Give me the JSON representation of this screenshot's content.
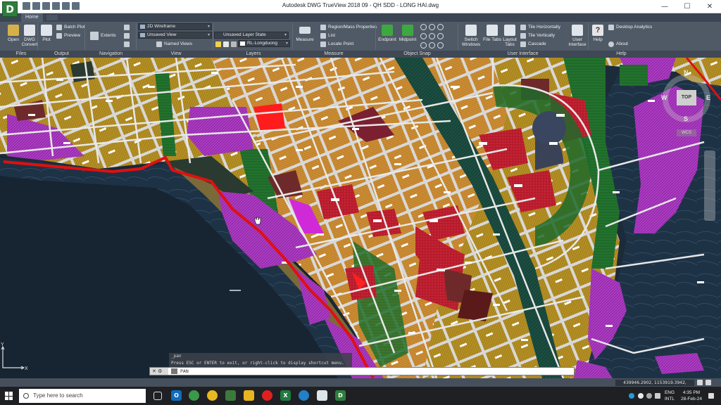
{
  "window": {
    "title": "Autodesk DWG TrueView 2018    09 - QH SDD - LONG HAI.dwg",
    "logo": "D",
    "controls": [
      "—",
      "☐",
      "✕"
    ]
  },
  "tabs": {
    "home": "Home"
  },
  "ribbon": {
    "files": {
      "open": "Open",
      "dwg_convert": "DWG\nConvert",
      "title": "Files"
    },
    "output": {
      "plot": "Plot",
      "batch_plot": "Batch Plot",
      "preview": "Preview",
      "title": "Output"
    },
    "navigation": {
      "extents": "Extents",
      "title": "Navigation"
    },
    "view": {
      "visual_style": "2D Wireframe",
      "named_view": "Unsaved View",
      "named_views": "Named Views",
      "title": "View"
    },
    "layers": {
      "layer_state": "Unsaved Layer State",
      "current_layer": "RL-Longduong",
      "title": "Layers"
    },
    "measure": {
      "measure": "Measure",
      "region_mass": "Region/Mass Properties",
      "list": "List",
      "locate_point": "Locate Point",
      "title": "Measure"
    },
    "object_snap": {
      "endpoint": "Endpoint",
      "midpoint": "Midpoint",
      "title": "Object Snap"
    },
    "user_interface": {
      "switch_windows": "Switch\nWindows",
      "file_tabs": "File Tabs",
      "layout_tabs": "Layout\nTabs",
      "tile_h": "Tile Horizontally",
      "tile_v": "Tile Vertically",
      "cascade": "Cascade",
      "user_interface": "User\nInterface",
      "title": "User Interface"
    },
    "help": {
      "help": "Help",
      "desktop_analytics": "Desktop Analytics",
      "about": "About",
      "title": "Help"
    }
  },
  "viewcube": {
    "top": "TOP",
    "n": "N",
    "s": "S",
    "e": "E",
    "w": "W",
    "wcs": "WCS"
  },
  "ucs": {
    "x": "X",
    "y": "Y"
  },
  "command": {
    "history_1": "_pan",
    "history_2": "Press ESC or ENTER to exit, or right-click to display shortcut menu.",
    "prompt": "PAN"
  },
  "status": {
    "coords": "439946.2902, 1153919.3942, 0.0000"
  },
  "taskbar": {
    "search_placeholder": "Type here to search",
    "lang_1": "ENG",
    "lang_2": "INTL",
    "time": "4:35 PM",
    "date": "28-Feb-24"
  },
  "colors": {
    "land_gold": "#a8841c",
    "land_orange": "#c0822a",
    "land_red": "#b81c2c",
    "land_maroon": "#6e2a2a",
    "land_green": "#1f6a2a",
    "land_purple": "#9a2cb0",
    "water": "#1c2b3a",
    "boundary": "#e01010"
  }
}
